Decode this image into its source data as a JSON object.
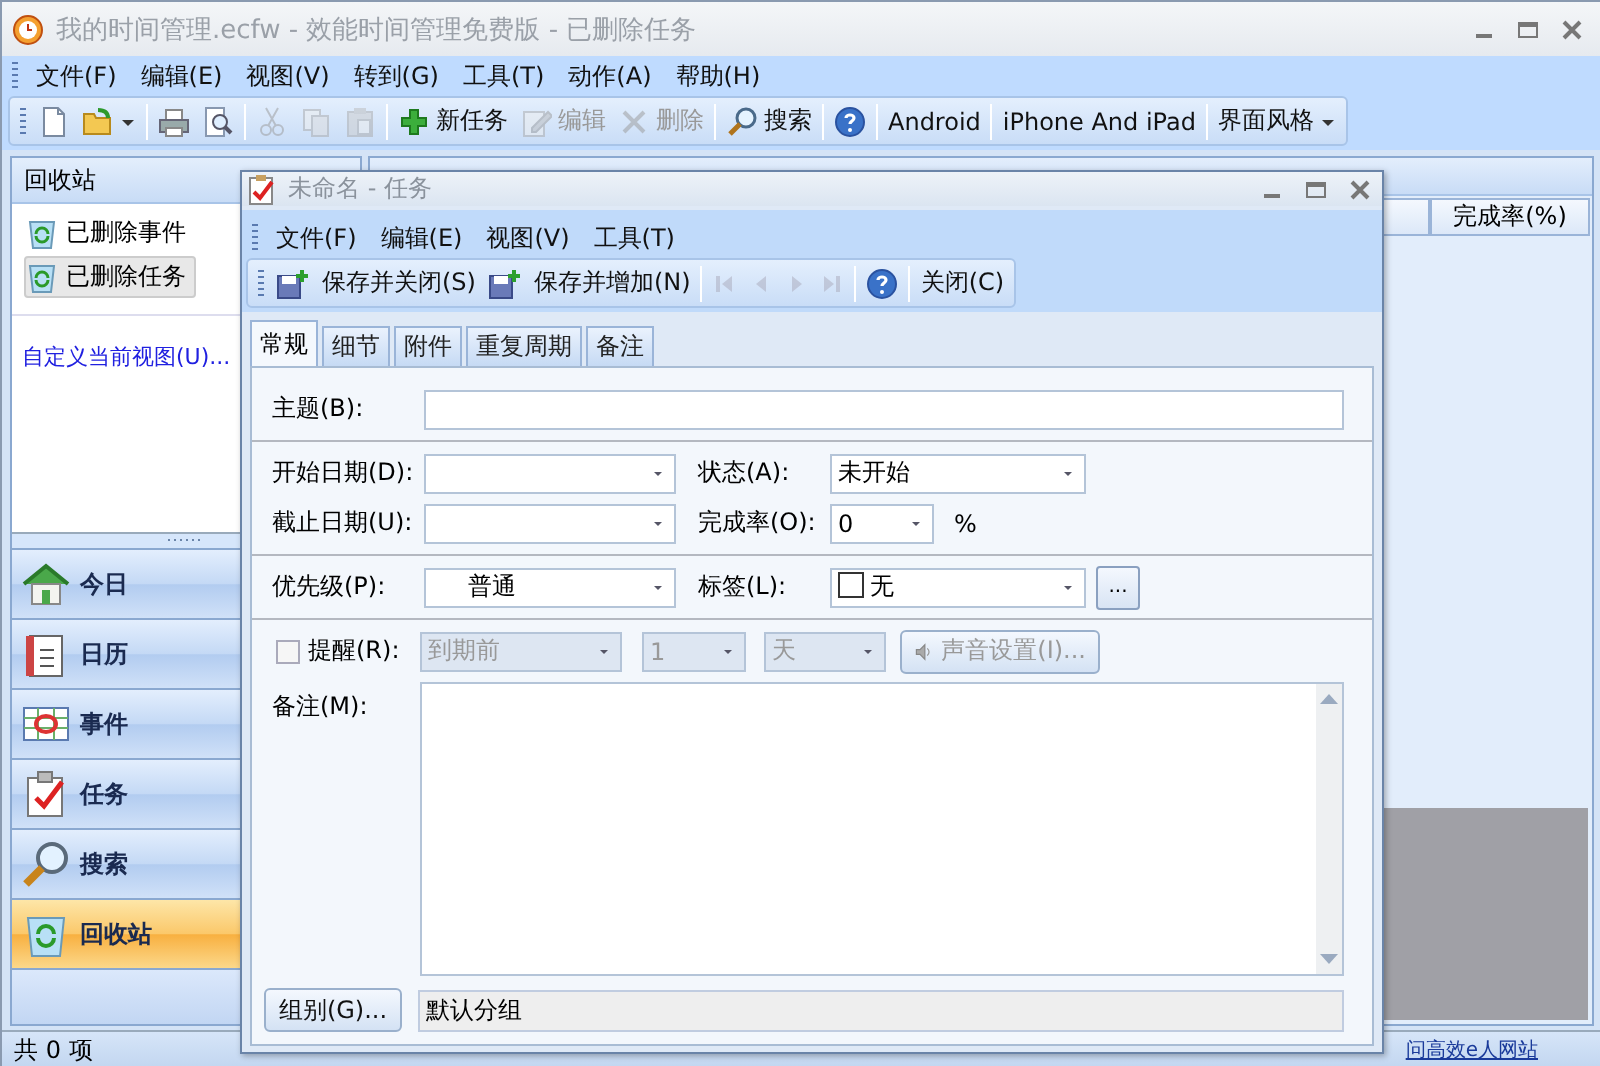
{
  "window": {
    "title": "我的时间管理.ecfw - 效能时间管理免费版 - 已删除任务"
  },
  "menu": [
    "文件(F)",
    "编辑(E)",
    "视图(V)",
    "转到(G)",
    "工具(T)",
    "动作(A)",
    "帮助(H)"
  ],
  "toolbar": [
    {
      "kind": "new",
      "disabled": false
    },
    {
      "kind": "open",
      "disabled": false
    },
    {
      "kind": "separator"
    },
    {
      "kind": "print",
      "disabled": false
    },
    {
      "kind": "preview",
      "disabled": false
    },
    {
      "kind": "separator"
    },
    {
      "kind": "cut",
      "disabled": true
    },
    {
      "kind": "copy",
      "disabled": true
    },
    {
      "kind": "paste",
      "disabled": true
    },
    {
      "kind": "separator"
    },
    {
      "kind": "add",
      "label": "新任务",
      "disabled": false
    },
    {
      "kind": "edit",
      "label": "编辑",
      "disabled": true
    },
    {
      "kind": "delete",
      "label": "删除",
      "disabled": true
    },
    {
      "kind": "separator"
    },
    {
      "kind": "search",
      "label": "搜索",
      "disabled": false
    },
    {
      "kind": "separator"
    },
    {
      "kind": "help",
      "disabled": false
    },
    {
      "kind": "separator"
    },
    {
      "kind": "text",
      "label": "Android",
      "disabled": false
    },
    {
      "kind": "separator"
    },
    {
      "kind": "text",
      "label": "iPhone And iPad",
      "disabled": false
    },
    {
      "kind": "separator"
    },
    {
      "kind": "dropdown",
      "label": "界面风格",
      "disabled": false
    }
  ],
  "sidebar": {
    "title": "回收站",
    "items": [
      {
        "label": "已删除事件",
        "selected": false
      },
      {
        "label": "已删除任务",
        "selected": true
      }
    ],
    "link": "自定义当前视图(U)..."
  },
  "navigation": [
    {
      "kind": "today",
      "label": "今日",
      "selected": false
    },
    {
      "kind": "calendar",
      "label": "日历",
      "selected": false
    },
    {
      "kind": "events",
      "label": "事件",
      "selected": false
    },
    {
      "kind": "tasks",
      "label": "任务",
      "selected": false
    },
    {
      "kind": "search",
      "label": "搜索",
      "selected": false
    },
    {
      "kind": "recycle",
      "label": "回收站",
      "selected": true
    }
  ],
  "list": {
    "columns": [
      "完成率(%)"
    ]
  },
  "status_bar": {
    "count": "共 0 项",
    "link": "问高效e人网站"
  },
  "dialog": {
    "title": "未命名 - 任务",
    "menu": [
      "文件(F)",
      "编辑(E)",
      "视图(V)",
      "工具(T)"
    ],
    "toolbar": [
      {
        "kind": "save-close",
        "label": "保存并关闭(S)",
        "disabled": false
      },
      {
        "kind": "save-add",
        "label": "保存并增加(N)",
        "disabled": false
      },
      {
        "kind": "separator"
      },
      {
        "kind": "first",
        "disabled": true
      },
      {
        "kind": "prev",
        "disabled": true
      },
      {
        "kind": "next",
        "disabled": true
      },
      {
        "kind": "last",
        "disabled": true
      },
      {
        "kind": "separator"
      },
      {
        "kind": "help",
        "disabled": false
      },
      {
        "kind": "separator"
      },
      {
        "kind": "text",
        "label": "关闭(C)",
        "disabled": false
      }
    ],
    "tabs": [
      {
        "label": "常规",
        "selected": true
      },
      {
        "label": "细节",
        "selected": false
      },
      {
        "label": "附件",
        "selected": false
      },
      {
        "label": "重复周期",
        "selected": false
      },
      {
        "label": "备注",
        "selected": false
      }
    ],
    "form": {
      "subject": {
        "label": "主题(B):"
      },
      "start_date": {
        "label": "开始日期(D):"
      },
      "status": {
        "label": "状态(A):",
        "value": "未开始"
      },
      "due_date": {
        "label": "截止日期(U):"
      },
      "completion": {
        "label": "完成率(O):",
        "value": "0",
        "unit": "%"
      },
      "priority": {
        "label": "优先级(P):",
        "value": "普通"
      },
      "tag": {
        "label": "标签(L):",
        "value": "无",
        "button": "..."
      },
      "reminder": {
        "label": "提醒(R):",
        "checked": false,
        "timing": "到期前",
        "amount": "1",
        "unit": "天",
        "sound_button": "声音设置(I)..."
      },
      "notes": {
        "label": "备注(M):"
      },
      "group": {
        "button": "组别(G)...",
        "value": "默认分组"
      }
    }
  }
}
